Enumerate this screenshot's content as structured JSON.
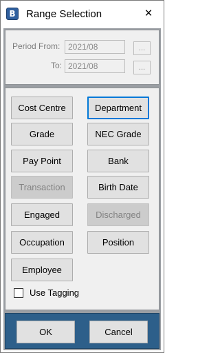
{
  "window": {
    "title": "Range Selection",
    "close_icon": "×",
    "app_icon_glyph": "B"
  },
  "period": {
    "from_label": "Period From:",
    "from_value": "2021/08",
    "from_browse": "...",
    "to_label": "To:",
    "to_value": "2021/08",
    "to_browse": "..."
  },
  "options": {
    "cost_centre": "Cost Centre",
    "department": "Department",
    "grade": "Grade",
    "nec_grade": "NEC Grade",
    "pay_point": "Pay Point",
    "bank": "Bank",
    "transaction": "Transaction",
    "birth_date": "Birth Date",
    "engaged": "Engaged",
    "discharged": "Discharged",
    "occupation": "Occupation",
    "position": "Position",
    "employee": "Employee",
    "use_tagging": "Use Tagging",
    "use_tagging_checked": false,
    "selected": "Department",
    "disabled": [
      "Transaction",
      "Discharged"
    ]
  },
  "footer": {
    "ok": "OK",
    "cancel": "Cancel"
  },
  "colors": {
    "frame": "#9a9ea3",
    "footer": "#2d5f8a",
    "selected_border": "#0078d7",
    "panel": "#f0f0f0"
  }
}
